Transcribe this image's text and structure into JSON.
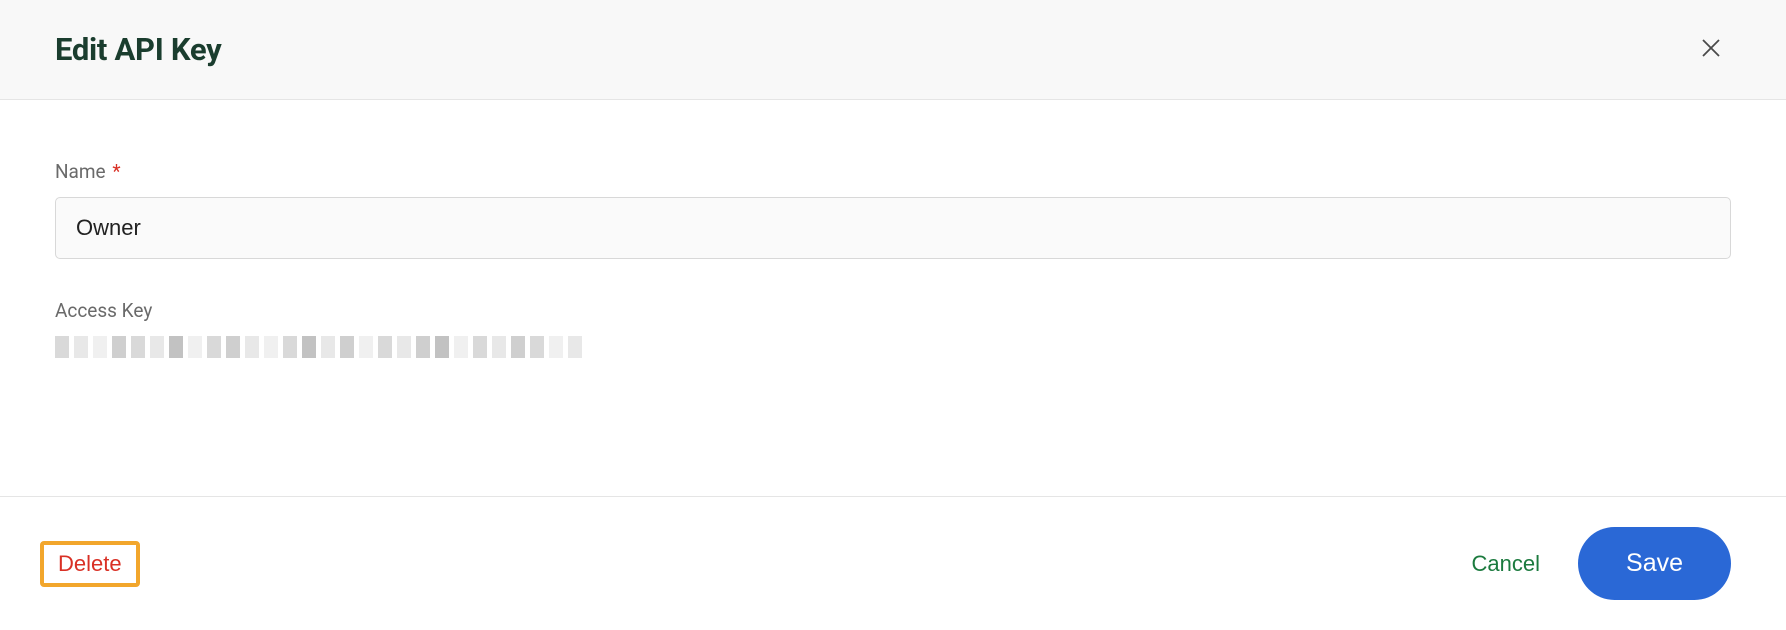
{
  "dialog": {
    "title": "Edit API Key"
  },
  "form": {
    "name_label": "Name",
    "required_mark": "*",
    "name_value": "Owner",
    "access_key_label": "Access Key"
  },
  "actions": {
    "delete_label": "Delete",
    "cancel_label": "Cancel",
    "save_label": "Save"
  }
}
